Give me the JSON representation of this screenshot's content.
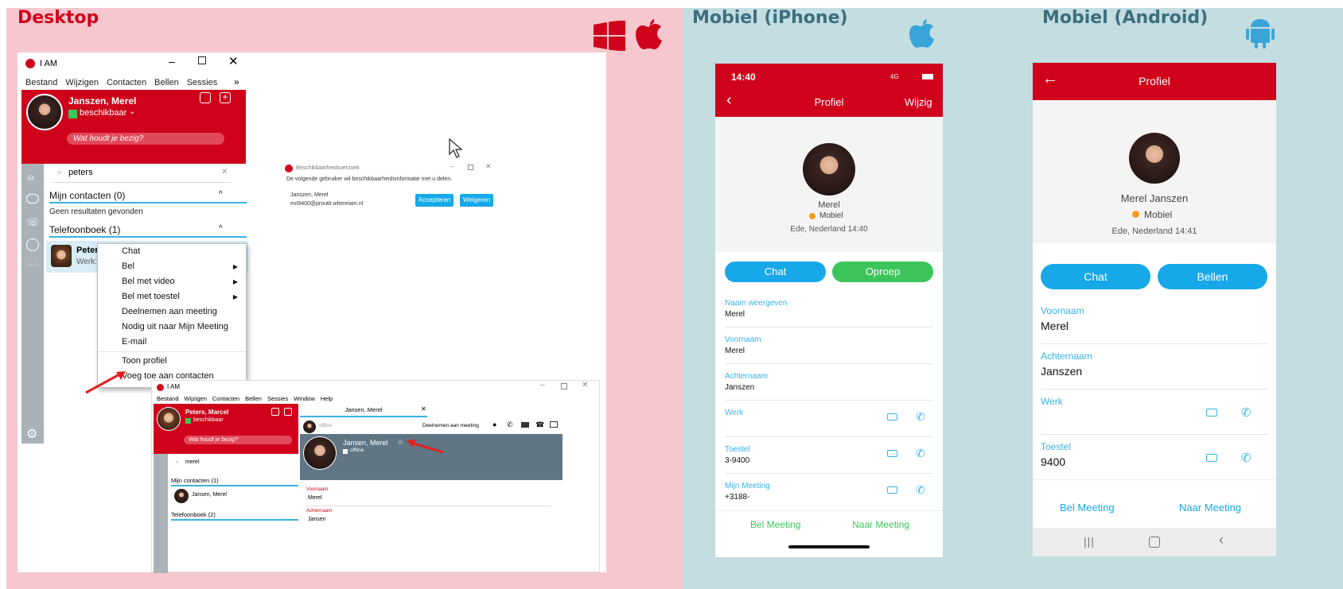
{
  "sections": {
    "desktop": "Desktop",
    "iphone": "Mobiel  (iPhone)",
    "android": "Mobiel (Android)"
  },
  "colors": {
    "brand_red": "#d0021b",
    "chat_blue": "#16a8e8",
    "call_green": "#3cc55a",
    "desktop_bg": "#f6c7cf",
    "mobile_bg": "#c3dde1"
  },
  "desktop": {
    "app_title": "I AM",
    "menu": [
      "Bestand",
      "Wijzigen",
      "Contacten",
      "Bellen",
      "Sessies"
    ],
    "profile": {
      "name": "Janszen, Merel",
      "status": "beschikbaar",
      "status_placeholder": "Wat houdt je bezig?"
    },
    "search": {
      "value": "peters"
    },
    "my_contacts": {
      "header": "Mijn contacten (0)",
      "empty": "Geen resultaten gevonden"
    },
    "phonebook": {
      "header": "Telefoonboek (1)",
      "entry_name": "Peter",
      "entry_sub": "Werk:"
    },
    "context_menu": [
      "Chat",
      "Bel",
      "Bel met video",
      "Bel met toestel",
      "Deelnemen aan meeting",
      "Nodig uit naar Mijn Meeting",
      "E-mail",
      "Toon profiel",
      "Voeg toe aan contacten"
    ],
    "request": {
      "title": "Beschikbaarheidsverzoek",
      "text": "De volgende gebruiker wil beschikbaarheidsinformatie met u delen.",
      "user": "Janszen, Merel",
      "email": "ext9400@proutit.whereiam.nl",
      "accept": "Accepteren",
      "decline": "Weigeren"
    },
    "second": {
      "app_title": "I AM",
      "menu": [
        "Bestand",
        "Wijzigen",
        "Contacten",
        "Bellen",
        "Sessies",
        "Window",
        "Help"
      ],
      "profile": {
        "name": "Peters, Marcel",
        "status": "beschikbaar",
        "status_placeholder": "Wat houdt je bezig?"
      },
      "search": "merel",
      "my_contacts": "Mijn contacten (1)",
      "contact": "Jansen, Merel",
      "phonebook": "Telefoonboek (2)",
      "tab": "Jansen, Merel",
      "tab_status": "offline",
      "join_meeting": "Deelnemen aan meeting",
      "card_name": "Jansen, Merel",
      "card_status": "offline",
      "field_label_1": "Voornaam",
      "field_value_1": "Merel",
      "field_label_2": "Achternaam",
      "field_value_2": "Jansen"
    }
  },
  "iphone": {
    "time": "14:40",
    "signal": "4G",
    "title": "Profiel",
    "edit": "Wijzig",
    "name": "Merel",
    "status": "Mobiel",
    "location": "Ede, Nederland 14:40",
    "chat": "Chat",
    "call": "Oproep",
    "fields": [
      {
        "label": "Naam weergeven",
        "value": "Merel"
      },
      {
        "label": "Voornaam",
        "value": "Merel"
      },
      {
        "label": "Achternaam",
        "value": "Janszen"
      },
      {
        "label": "Werk",
        "value": ""
      },
      {
        "label": "Toestel",
        "value": "3-9400"
      },
      {
        "label": "Mijn Meeting",
        "value": "+3188-"
      }
    ],
    "bel_meeting": "Bel Meeting",
    "naar_meeting": "Naar Meeting"
  },
  "android": {
    "title": "Profiel",
    "name": "Merel Janszen",
    "status": "Mobiel",
    "location": "Ede, Nederland 14:41",
    "chat": "Chat",
    "call": "Bellen",
    "fields": [
      {
        "label": "Voornaam",
        "value": "Merel"
      },
      {
        "label": "Achternaam",
        "value": "Janszen"
      },
      {
        "label": "Werk",
        "value": ""
      },
      {
        "label": "Toestel",
        "value": "9400"
      }
    ],
    "bel_meeting": "Bel Meeting",
    "naar_meeting": "Naar Meeting"
  }
}
